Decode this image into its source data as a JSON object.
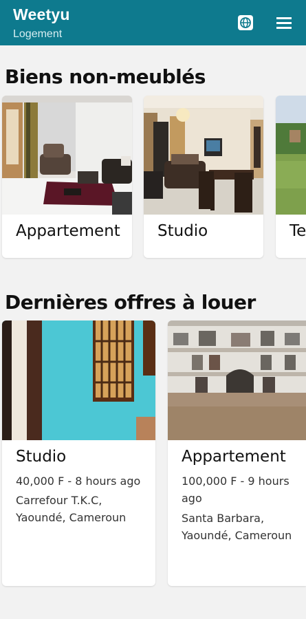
{
  "app": {
    "title": "Weetyu",
    "subtitle": "Logement"
  },
  "icons": {
    "globe": "globe-icon",
    "menu": "menu-icon"
  },
  "colors": {
    "appbar": "#0e7a8e",
    "background": "#f2f2f2"
  },
  "sections": [
    {
      "title": "Biens non-meublés",
      "cards": [
        {
          "label": "Appartement"
        },
        {
          "label": "Studio"
        },
        {
          "label": "Te"
        }
      ]
    },
    {
      "title": "Dernières offres à louer",
      "offers": [
        {
          "label": "Studio",
          "meta": "40,000 F - 8 hours ago",
          "location": "Carrefour T.K.C, Yaoundé, Cameroun"
        },
        {
          "label": "Appartement",
          "meta": "100,000 F - 9 hours ago",
          "location": "Santa Barbara, Yaoundé, Cameroun"
        }
      ]
    }
  ]
}
